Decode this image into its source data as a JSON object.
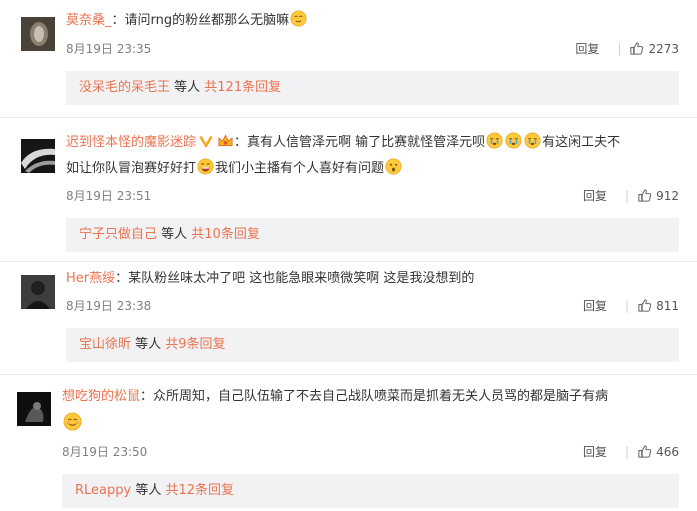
{
  "comments": [
    {
      "username": "莫奈桑_",
      "text": "：请问rng的粉丝都那么无脑嘛",
      "date": "8月19日 23:35",
      "reply_label": "回复",
      "likes": "2273",
      "sub_user": "没呆毛的呆毛王",
      "sub_mid": " 等人 ",
      "sub_count": "共121条回复"
    },
    {
      "username": "迟到怪本怪的魔影迷踪",
      "text_a": "：真有人信管泽元啊 输了比赛就怪管泽元呗",
      "text_b": "有这闲工夫不",
      "text_c": "如让你队冒泡赛好好打",
      "text_d": "我们小主播有个人喜好有问题",
      "date": "8月19日 23:51",
      "reply_label": "回复",
      "likes": "912",
      "sub_user": "宁子只做自己",
      "sub_mid": " 等人 ",
      "sub_count": "共10条回复"
    },
    {
      "username": "Her燕绥",
      "text": "：某队粉丝味太冲了吧 这也能急眼来喷微笑啊 这是我没想到的",
      "date": "8月19日 23:38",
      "reply_label": "回复",
      "likes": "811",
      "sub_user": "宝山徐昕",
      "sub_mid": " 等人 ",
      "sub_count": "共9条回复"
    },
    {
      "username": "想吃狗的松鼠",
      "text": "：众所周知，自己队伍输了不去自己战队喷菜而是抓着无关人员骂的都是脑子有病",
      "date": "8月19日 23:50",
      "reply_label": "回复",
      "likes": "466",
      "sub_user": "RLeappy",
      "sub_mid": " 等人 ",
      "sub_count": "共12条回复"
    }
  ],
  "icons": {
    "like": "thumb-up-icon",
    "emoji_smile": "smirk-emoji",
    "emoji_cry": "crying-emoji",
    "emoji_laugh": "laugh-emoji",
    "emoji_hmm": "thinking-emoji",
    "emoji_happy": "smile-emoji"
  },
  "colors": {
    "username": "#eb7350",
    "link": "#eb7350",
    "meta": "#808080",
    "subbox_bg": "#f2f2f5"
  }
}
